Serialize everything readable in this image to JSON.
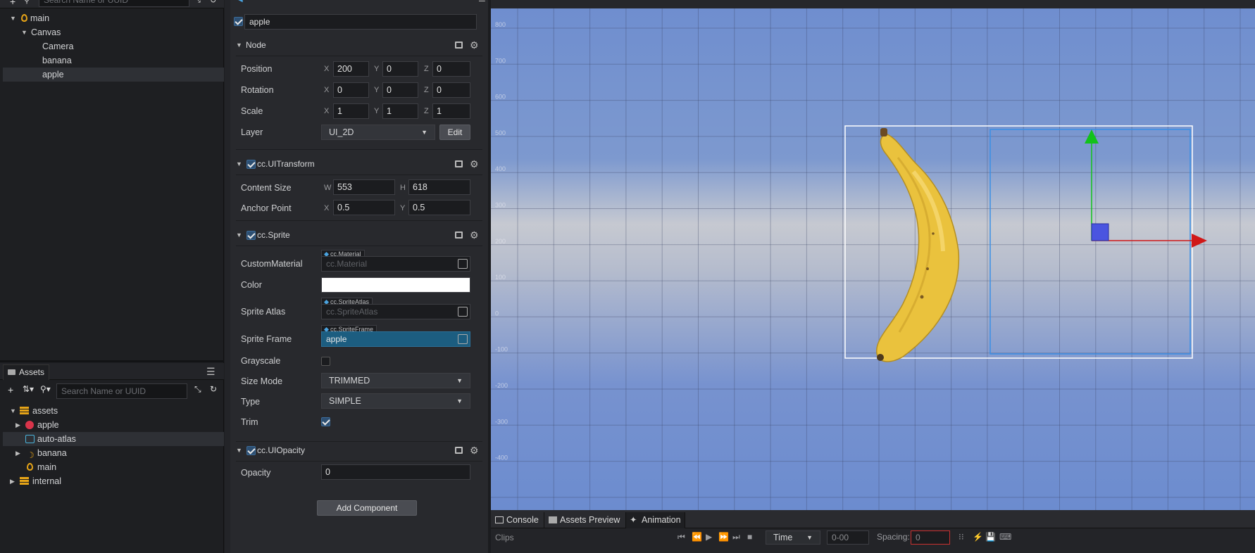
{
  "hierarchy": {
    "search_placeholder": "Search Name or UUID",
    "nodes": [
      {
        "label": "main",
        "icon": "scene-icon"
      },
      {
        "label": "Canvas"
      },
      {
        "label": "Camera"
      },
      {
        "label": "banana"
      },
      {
        "label": "apple",
        "selected": true
      }
    ]
  },
  "assets": {
    "tab_label": "Assets",
    "search_placeholder": "Search Name or UUID",
    "items": [
      {
        "label": "assets",
        "icon": "database-icon"
      },
      {
        "label": "apple",
        "icon": "prefab-icon"
      },
      {
        "label": "auto-atlas",
        "icon": "atlas-icon",
        "selected": true
      },
      {
        "label": "banana",
        "icon": "sprite-icon"
      },
      {
        "label": "main",
        "icon": "scene-icon"
      },
      {
        "label": "internal",
        "icon": "database-icon"
      }
    ]
  },
  "inspector": {
    "node_name": "apple",
    "node_section": {
      "title": "Node",
      "position_label": "Position",
      "position": {
        "x": "200",
        "y": "0",
        "z": "0"
      },
      "rotation_label": "Rotation",
      "rotation": {
        "x": "0",
        "y": "0",
        "z": "0"
      },
      "scale_label": "Scale",
      "scale": {
        "x": "1",
        "y": "1",
        "z": "1"
      },
      "layer_label": "Layer",
      "layer_value": "UI_2D",
      "edit_label": "Edit"
    },
    "uitransform": {
      "title": "cc.UITransform",
      "content_size_label": "Content Size",
      "w": "553",
      "h": "618",
      "anchor_label": "Anchor Point",
      "ax": "0.5",
      "ay": "0.5"
    },
    "sprite": {
      "title": "cc.Sprite",
      "custom_material_label": "CustomMaterial",
      "material_tag": "cc.Material",
      "material_value": "cc.Material",
      "color_label": "Color",
      "color_value": "#ffffff",
      "atlas_label": "Sprite Atlas",
      "atlas_tag": "cc.SpriteAtlas",
      "atlas_value": "cc.SpriteAtlas",
      "frame_label": "Sprite Frame",
      "frame_tag": "cc.SpriteFrame",
      "frame_value": "apple",
      "grayscale_label": "Grayscale",
      "size_mode_label": "Size Mode",
      "size_mode_value": "TRIMMED",
      "type_label": "Type",
      "type_value": "SIMPLE",
      "trim_label": "Trim"
    },
    "uiopacity": {
      "title": "cc.UIOpacity",
      "opacity_label": "Opacity",
      "opacity_value": "0"
    },
    "add_component_label": "Add Component",
    "axis": {
      "x": "X",
      "y": "Y",
      "z": "Z",
      "w": "W",
      "h": "H"
    }
  },
  "scene": {
    "y_ticks": [
      "800",
      "700",
      "600",
      "500",
      "400",
      "300",
      "200",
      "100",
      "0",
      "-100",
      "-200",
      "-300",
      "-400"
    ]
  },
  "bottom_panel": {
    "tabs": [
      "Console",
      "Assets Preview",
      "Animation"
    ],
    "clips_label": "Clips",
    "time_label": "Time",
    "time_value": "0-00",
    "spacing_label": "Spacing:",
    "spacing_value": "0"
  },
  "colors": {
    "accent": "#1c5d80",
    "selection_box": "#3f8fe0",
    "gizmo_x": "#d01818",
    "gizmo_y": "#12c21a"
  }
}
